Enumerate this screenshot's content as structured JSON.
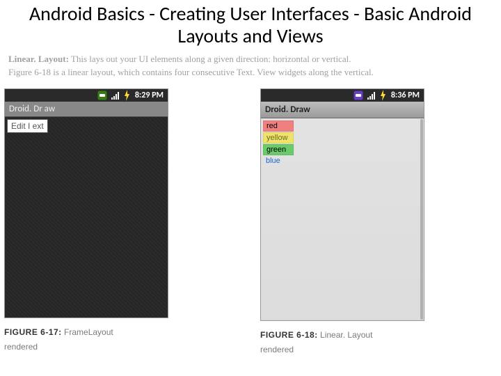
{
  "title": "Android Basics - Creating User Interfaces - Basic Android Layouts and Views",
  "intro": {
    "p1_lead": "Linear. Layout:",
    "p1_rest": " This lays out your UI elements along a given direction: horizontal or vertical.",
    "p2": "Figure 6-18 is a linear layout, which contains four consecutive Text. View widgets along the vertical."
  },
  "fig1": {
    "statusbar_time": "8:29 PM",
    "titlebar": "Droid. Dr aw",
    "edittext": "Edit I ext",
    "caption_label": "FIGURE 6-17:",
    "caption_name": "FrameLayout",
    "caption_line2": "rendered"
  },
  "fig2": {
    "statusbar_time": "8:36 PM",
    "titlebar": "Droid. Draw",
    "rows": {
      "r1": "red",
      "r2": "yellow",
      "r3": "green",
      "r4": "blue"
    },
    "caption_label": "FIGURE 6-18:",
    "caption_name": "Linear. Layout",
    "caption_line2": "rendered"
  }
}
